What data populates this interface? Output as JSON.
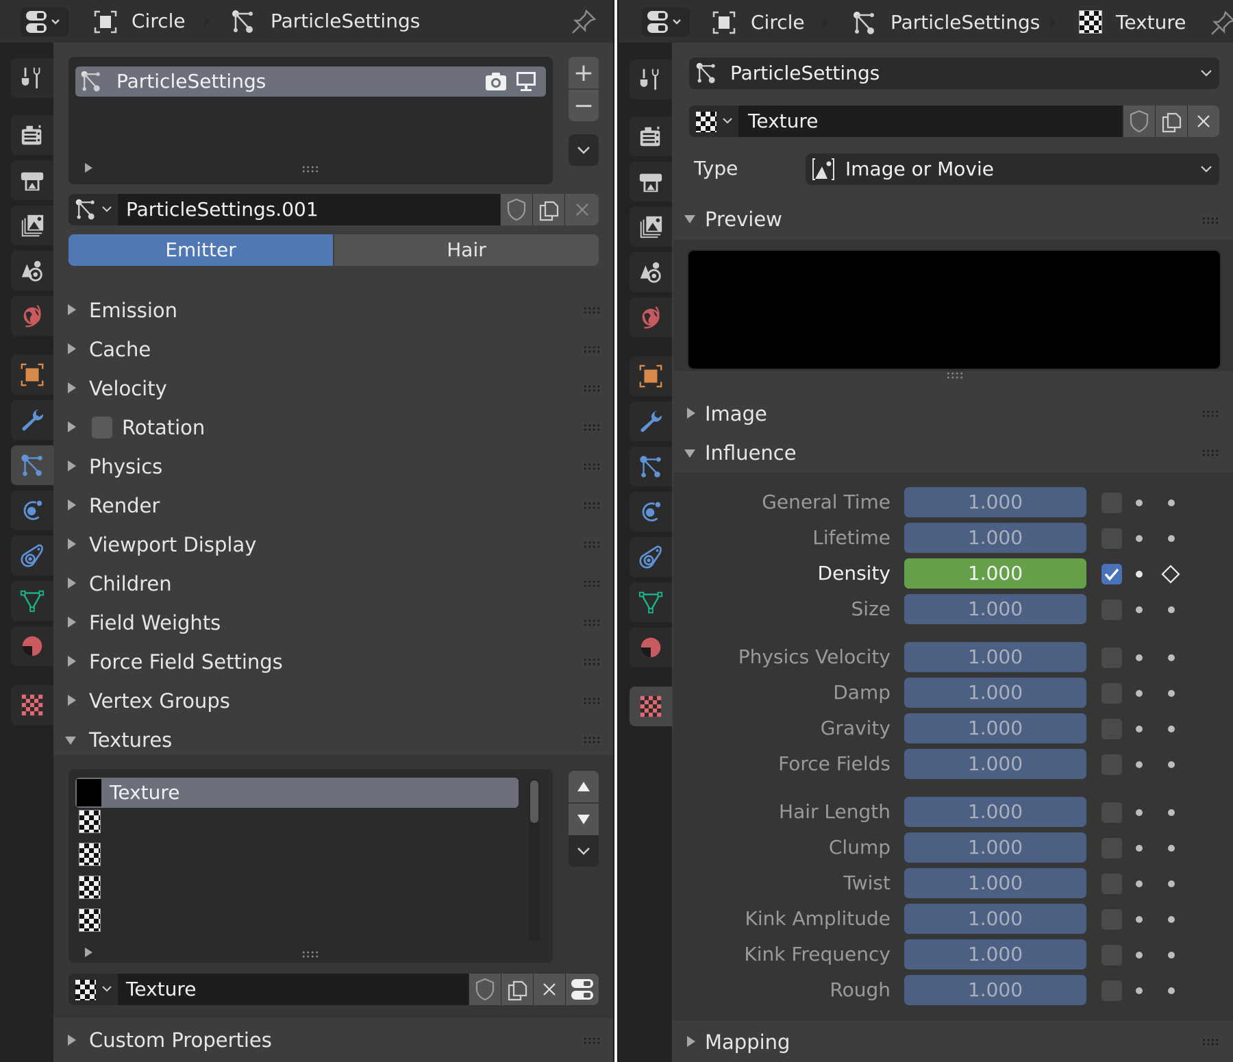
{
  "left": {
    "breadcrumb": [
      "Circle",
      "ParticleSettings"
    ],
    "particle_list": {
      "items": [
        {
          "name": "ParticleSettings",
          "selected": true
        }
      ],
      "add_label": "+",
      "remove_label": "−"
    },
    "datablock": {
      "name": "ParticleSettings.001"
    },
    "type_tabs": [
      {
        "label": "Emitter",
        "active": true
      },
      {
        "label": "Hair",
        "active": false
      }
    ],
    "sections": [
      {
        "label": "Emission",
        "expanded": false
      },
      {
        "label": "Cache",
        "expanded": false
      },
      {
        "label": "Velocity",
        "expanded": false
      },
      {
        "label": "Rotation",
        "expanded": false,
        "has_checkbox": true,
        "checked": false
      },
      {
        "label": "Physics",
        "expanded": false
      },
      {
        "label": "Render",
        "expanded": false
      },
      {
        "label": "Viewport Display",
        "expanded": false
      },
      {
        "label": "Children",
        "expanded": false
      },
      {
        "label": "Field Weights",
        "expanded": false
      },
      {
        "label": "Force Field Settings",
        "expanded": false
      },
      {
        "label": "Vertex Groups",
        "expanded": false
      },
      {
        "label": "Textures",
        "expanded": true
      }
    ],
    "texture_slots": [
      {
        "name": "Texture",
        "selected": true,
        "icon": "black-swatch"
      },
      {
        "name": "",
        "icon": "checker-icon"
      },
      {
        "name": "",
        "icon": "checker-icon"
      },
      {
        "name": "",
        "icon": "checker-icon"
      },
      {
        "name": "",
        "icon": "checker-icon"
      }
    ],
    "texture_datablock": {
      "name": "Texture"
    },
    "custom_properties_label": "Custom Properties"
  },
  "right": {
    "breadcrumb": [
      "Circle",
      "ParticleSettings",
      "Texture"
    ],
    "particle_dropdown": "ParticleSettings",
    "texture_datablock": {
      "name": "Texture"
    },
    "type": {
      "label": "Type",
      "value": "Image or Movie"
    },
    "sections": {
      "preview": "Preview",
      "image": "Image",
      "influence": "Influence",
      "mapping": "Mapping"
    },
    "influence": {
      "groups": [
        [
          {
            "label": "General Time",
            "value": "1.000",
            "enabled": false
          },
          {
            "label": "Lifetime",
            "value": "1.000",
            "enabled": false
          },
          {
            "label": "Density",
            "value": "1.000",
            "enabled": true
          },
          {
            "label": "Size",
            "value": "1.000",
            "enabled": false
          }
        ],
        [
          {
            "label": "Physics Velocity",
            "value": "1.000",
            "enabled": false
          },
          {
            "label": "Damp",
            "value": "1.000",
            "enabled": false
          },
          {
            "label": "Gravity",
            "value": "1.000",
            "enabled": false
          },
          {
            "label": "Force Fields",
            "value": "1.000",
            "enabled": false
          }
        ],
        [
          {
            "label": "Hair Length",
            "value": "1.000",
            "enabled": false
          },
          {
            "label": "Clump",
            "value": "1.000",
            "enabled": false
          },
          {
            "label": "Twist",
            "value": "1.000",
            "enabled": false
          },
          {
            "label": "Kink Amplitude",
            "value": "1.000",
            "enabled": false
          },
          {
            "label": "Kink Frequency",
            "value": "1.000",
            "enabled": false
          },
          {
            "label": "Rough",
            "value": "1.000",
            "enabled": false
          }
        ]
      ]
    }
  },
  "tabs": [
    {
      "name": "tool",
      "color": "#cccccc"
    },
    {
      "name": "render",
      "color": "#cccccc"
    },
    {
      "name": "output",
      "color": "#cccccc"
    },
    {
      "name": "view-layer",
      "color": "#cccccc"
    },
    {
      "name": "scene",
      "color": "#cccccc"
    },
    {
      "name": "world",
      "color": "#c95a5f"
    },
    {
      "name": "object",
      "color": "#d88a4a"
    },
    {
      "name": "modifiers",
      "color": "#5f93d6"
    },
    {
      "name": "particles",
      "color": "#5f93d6"
    },
    {
      "name": "physics",
      "color": "#5f93d6"
    },
    {
      "name": "constraints",
      "color": "#5f93d6"
    },
    {
      "name": "data",
      "color": "#1cb58a"
    },
    {
      "name": "material",
      "color": "#c95a5f"
    },
    {
      "name": "texture",
      "color": "#e26872"
    }
  ],
  "colors": {
    "accent_blue": "#5078b4",
    "slider_blue": "#4b6083",
    "density_green": "#65a04a",
    "checkbox_blue": "#4a72b8"
  }
}
